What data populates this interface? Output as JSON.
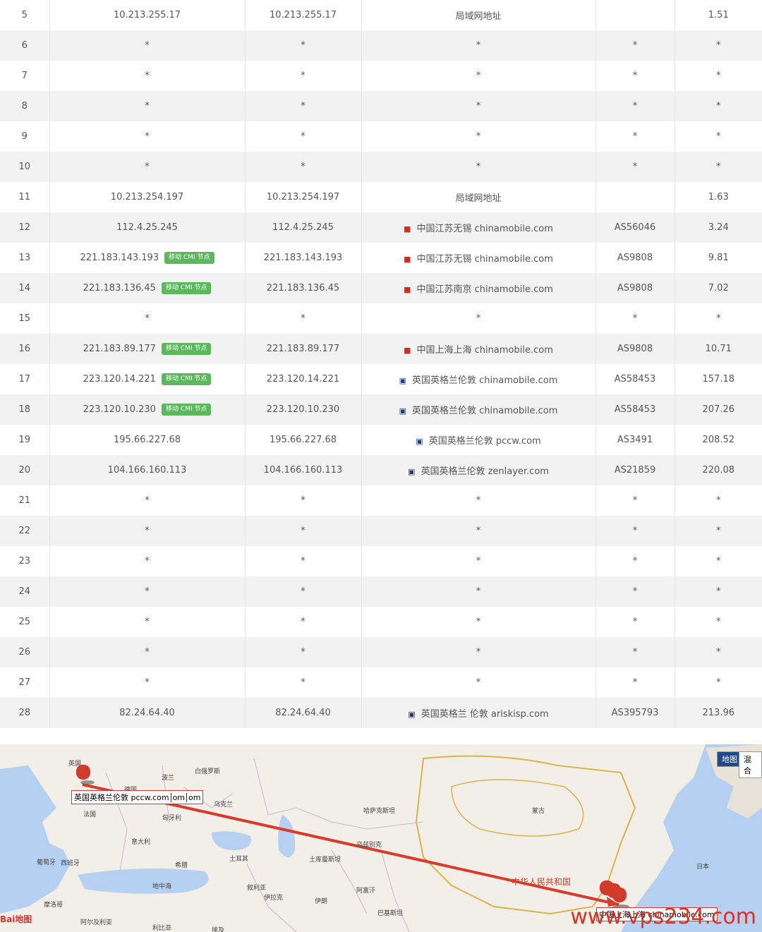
{
  "badge_text": "移动 CMI 节点",
  "rows": [
    {
      "hop": "5",
      "ip": "10.213.255.17",
      "host": "10.213.255.17",
      "flag": "",
      "location": "局域网地址",
      "as": "",
      "time": "1.51"
    },
    {
      "hop": "6",
      "ip": "*",
      "host": "*",
      "flag": "",
      "location": "*",
      "as": "*",
      "time": "*"
    },
    {
      "hop": "7",
      "ip": "*",
      "host": "*",
      "flag": "",
      "location": "*",
      "as": "*",
      "time": "*"
    },
    {
      "hop": "8",
      "ip": "*",
      "host": "*",
      "flag": "",
      "location": "*",
      "as": "*",
      "time": "*"
    },
    {
      "hop": "9",
      "ip": "*",
      "host": "*",
      "flag": "",
      "location": "*",
      "as": "*",
      "time": "*"
    },
    {
      "hop": "10",
      "ip": "*",
      "host": "*",
      "flag": "",
      "location": "*",
      "as": "*",
      "time": "*"
    },
    {
      "hop": "11",
      "ip": "10.213.254.197",
      "host": "10.213.254.197",
      "flag": "",
      "location": "局域网地址",
      "as": "",
      "time": "1.63"
    },
    {
      "hop": "12",
      "ip": "112.4.25.245",
      "host": "112.4.25.245",
      "flag": "cn",
      "location": "中国江苏无锡 chinamobile.com",
      "as": "AS56046",
      "time": "3.24"
    },
    {
      "hop": "13",
      "ip": "221.183.143.193",
      "badge": true,
      "host": "221.183.143.193",
      "flag": "cn",
      "location": "中国江苏无锡 chinamobile.com",
      "as": "AS9808",
      "time": "9.81"
    },
    {
      "hop": "14",
      "ip": "221.183.136.45",
      "badge": true,
      "host": "221.183.136.45",
      "flag": "cn",
      "location": "中国江苏南京 chinamobile.com",
      "as": "AS9808",
      "time": "7.02"
    },
    {
      "hop": "15",
      "ip": "*",
      "host": "*",
      "flag": "",
      "location": "*",
      "as": "*",
      "time": "*"
    },
    {
      "hop": "16",
      "ip": "221.183.89.177",
      "badge": true,
      "host": "221.183.89.177",
      "flag": "cn",
      "location": "中国上海上海 chinamobile.com",
      "as": "AS9808",
      "time": "10.71"
    },
    {
      "hop": "17",
      "ip": "223.120.14.221",
      "badge": true,
      "host": "223.120.14.221",
      "flag": "gb",
      "location": "英国英格兰伦敦 chinamobile.com",
      "as": "AS58453",
      "time": "157.18"
    },
    {
      "hop": "18",
      "ip": "223.120.10.230",
      "badge": true,
      "host": "223.120.10.230",
      "flag": "gb",
      "location": "英国英格兰伦敦 chinamobile.com",
      "as": "AS58453",
      "time": "207.26"
    },
    {
      "hop": "19",
      "ip": "195.66.227.68",
      "host": "195.66.227.68",
      "flag": "gb",
      "location": "英国英格兰伦敦 pccw.com",
      "as": "AS3491",
      "time": "208.52"
    },
    {
      "hop": "20",
      "ip": "104.166.160.113",
      "host": "104.166.160.113",
      "flag": "gb",
      "location": "英国英格兰伦敦 zenlayer.com",
      "as": "AS21859",
      "time": "220.08"
    },
    {
      "hop": "21",
      "ip": "*",
      "host": "*",
      "flag": "",
      "location": "*",
      "as": "*",
      "time": "*"
    },
    {
      "hop": "22",
      "ip": "*",
      "host": "*",
      "flag": "",
      "location": "*",
      "as": "*",
      "time": "*"
    },
    {
      "hop": "23",
      "ip": "*",
      "host": "*",
      "flag": "",
      "location": "*",
      "as": "*",
      "time": "*"
    },
    {
      "hop": "24",
      "ip": "*",
      "host": "*",
      "flag": "",
      "location": "*",
      "as": "*",
      "time": "*"
    },
    {
      "hop": "25",
      "ip": "*",
      "host": "*",
      "flag": "",
      "location": "*",
      "as": "*",
      "time": "*"
    },
    {
      "hop": "26",
      "ip": "*",
      "host": "*",
      "flag": "",
      "location": "*",
      "as": "*",
      "time": "*"
    },
    {
      "hop": "27",
      "ip": "*",
      "host": "*",
      "flag": "",
      "location": "*",
      "as": "*",
      "time": "*"
    },
    {
      "hop": "28",
      "ip": "82.24.64.40",
      "host": "82.24.64.40",
      "flag": "gb",
      "location": "英国英格兰 伦敦 ariskisp.com",
      "as": "AS395793",
      "time": "213.96"
    }
  ],
  "map": {
    "labels": {
      "uk": "英国",
      "poland": "波兰",
      "belarus": "白俄罗斯",
      "germany": "德国",
      "ukraine": "乌克兰",
      "france": "法国",
      "hungary": "匈牙利",
      "italy": "意大利",
      "kazakhstan": "哈萨克斯坦",
      "mongolia": "蒙古",
      "portugal": "葡萄牙",
      "spain": "西班牙",
      "greece": "希腊",
      "turkey": "土耳其",
      "turkmenistan": "土库曼斯坦",
      "uzbekistan": "乌兹别克",
      "mediterranean": "地中海",
      "syria": "叙利亚",
      "iraq": "伊拉克",
      "iran": "伊朗",
      "afghanistan": "阿富汗",
      "pakistan": "巴基斯坦",
      "morocco": "摩洛哥",
      "algeria": "阿尔及利亚",
      "libya": "利比亚",
      "egypt": "埃及",
      "china": "中华人民共和国",
      "japan": "日本"
    },
    "infobox_london": "英国英格兰伦敦 pccw.com",
    "infobox_london_suffix_1": "om",
    "infobox_london_suffix_2": "om",
    "infobox_shanghai": "中国上海上海 chinamobile.com",
    "maptype_map": "地图",
    "maptype_hybrid": "混合",
    "baidu_logo": "Bai地图",
    "watermark": "www.vps234.com"
  }
}
